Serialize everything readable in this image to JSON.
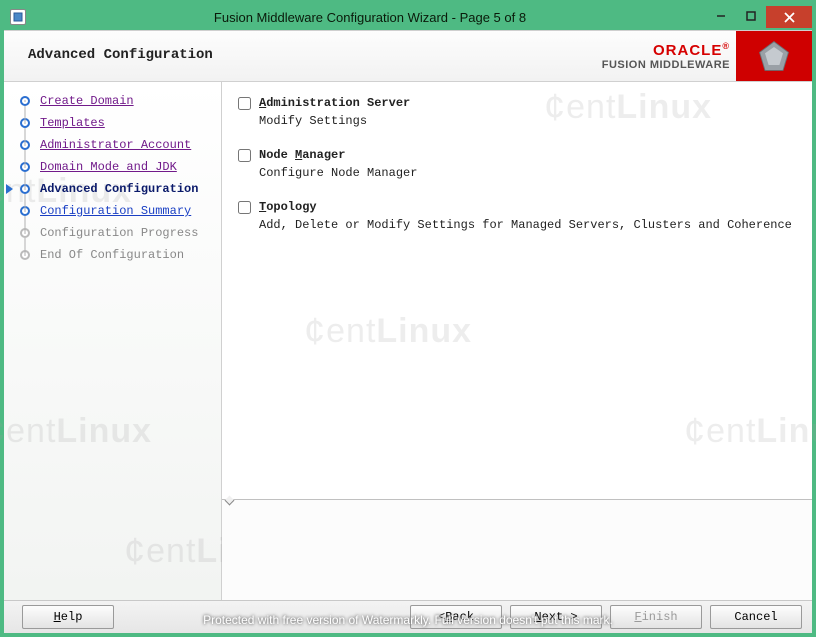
{
  "window": {
    "title": "Fusion Middleware Configuration Wizard - Page 5 of 8"
  },
  "header": {
    "page_title": "Advanced Configuration",
    "brand": "ORACLE",
    "brand_sub": "FUSION MIDDLEWARE"
  },
  "sidebar": {
    "steps": [
      {
        "label": "Create Domain",
        "state": "visited"
      },
      {
        "label": "Templates",
        "state": "visited"
      },
      {
        "label": "Administrator Account",
        "state": "visited"
      },
      {
        "label": "Domain Mode and JDK",
        "state": "visited"
      },
      {
        "label": "Advanced Configuration",
        "state": "current"
      },
      {
        "label": "Configuration Summary",
        "state": "link"
      },
      {
        "label": "Configuration Progress",
        "state": "future"
      },
      {
        "label": "End Of Configuration",
        "state": "future"
      }
    ]
  },
  "options": [
    {
      "id": "admin-server",
      "checked": false,
      "title_pre": "",
      "title_u": "A",
      "title_post": "dministration Server",
      "desc": "Modify Settings"
    },
    {
      "id": "node-manager",
      "checked": false,
      "title_pre": "Node ",
      "title_u": "M",
      "title_post": "anager",
      "desc": "Configure Node Manager"
    },
    {
      "id": "topology",
      "checked": false,
      "title_pre": "",
      "title_u": "T",
      "title_post": "opology",
      "desc": "Add, Delete or Modify Settings for Managed Servers, Clusters and Coherence"
    }
  ],
  "footer": {
    "help": "Help",
    "back": "< Back",
    "next": "Next >",
    "finish": "Finish",
    "cancel": "Cancel",
    "back_enabled": true,
    "next_enabled": true,
    "finish_enabled": false
  },
  "watermark_notice": "Protected with free version of Watermarkly. Full version doesn't put this mark.",
  "watermark_text": "¢entLinux"
}
